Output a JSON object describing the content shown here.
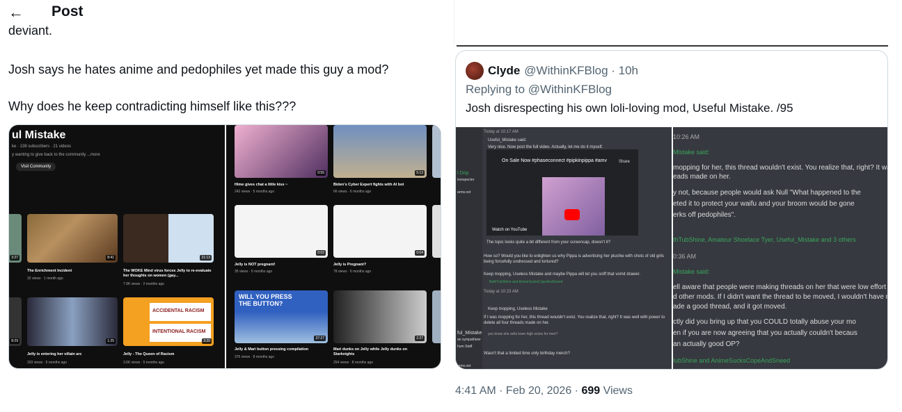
{
  "header": {
    "back_icon": "arrow-left-icon",
    "title": "Post"
  },
  "post": {
    "partial_line": "deviant.",
    "paragraph_1": "Josh says he hates anime and pedophiles yet made this guy a mod?",
    "paragraph_2": "Why does he keep contradicting himself like this???"
  },
  "media": {
    "channel": {
      "name": "ul Mistake",
      "subs": "ke · 138 subscribers · 21 videos",
      "desc": "y wanting to give back to the community ...more",
      "community_btn": "Visit Community"
    },
    "left_videos": [
      {
        "title": "The Enrichment Incident",
        "meta": "32 views · 1 month ago",
        "duration": "8:41"
      },
      {
        "title": "The WOKE Mind virus forces Jelly to re-evaluate her thoughts on women (gay...",
        "meta": "7.9K views · 2 months ago",
        "duration": "21:13"
      },
      {
        "title": "Jelly is entering her villain arc",
        "meta": "333 views · 5 months ago",
        "duration": "1:25"
      },
      {
        "title": "Jelly - The Queen of Racism",
        "meta": "3.6K views · 5 months ago",
        "duration": "3:20"
      }
    ],
    "racism_text_1": "ACCIDENTAL RACISM",
    "racism_text_2": "INTENTIONAL RACISM",
    "small_durations": [
      "3:27",
      "8:29"
    ],
    "right_videos": [
      {
        "title": "Hime gives chat a little kiss ~",
        "meta": "242 views · 5 months ago",
        "duration": "0:55"
      },
      {
        "title": "Biden's Cyber Expert fights with AI bot",
        "meta": "66 views · 6 months ago",
        "duration": "5:13"
      },
      {
        "title": "Jelly is NOT pregnant!",
        "meta": "35 views · 6 months ago",
        "duration": "0:02"
      },
      {
        "title": "Jelly is Pregnant?",
        "meta": "78 views · 6 months ago",
        "duration": "0:04"
      },
      {
        "title": "Jelly & Mari button pressing compilation",
        "meta": "376 views · 8 months ago",
        "duration": "37:27"
      },
      {
        "title": "Mari dunks on Jelly while Jelly dunks on Starknights",
        "meta": "254 views · 8 months ago",
        "duration": "2:27"
      }
    ],
    "button_text": "WILL YOU PRESS THE BUTTON?"
  },
  "quote": {
    "name": "Clyde",
    "handle": "@WithinKFBlog · 10h",
    "replying": "Replying to @WithinKFBlog",
    "text": "Josh disrespecting his own loli-loving mod, Useful Mistake. /95",
    "discord_left": {
      "timestamp": "Today at 10:17 AM",
      "quote_author": "Useful_Mistake said:",
      "quote_line": "Very nice. Now post the full video. Actually, let me do it myself.",
      "video_title": "On Sale Now #phaseconnect #pipkinpippa #amv",
      "share": "Share",
      "watch_on": "Watch on  YouTube",
      "caption": "The topic looks quite a bit different from your screencap, doesn't it?",
      "body1": "How so? Would you like to enlighten us why Pippa is advertising her plushie with shots of old girls being forcefully undressed and tortured?",
      "body2": "Keep mopping, Useless Mistake and maybe Pippa will let you sniff that vomit drawer.",
      "reactions": "BathTubShine and AnimeSucksCopeAndSneed",
      "timestamp2": "Today at 10:23 AM",
      "quote2": "Keep mopping, Useless Mistake",
      "body3": "If I was mopping for her, this thread wouldn't exist. You realize that, right? It was well with power to delete all four threads made on her.",
      "body4": "you know she sells knee high socks for men?",
      "body5": "Wasn't that a limited time only birthday merch?",
      "side_labels": [
        "l Drip",
        "isrespecter",
        "arms.net",
        "ful_Mistake",
        "an sympathizer",
        "hum Staff",
        "orms.net"
      ]
    },
    "discord_right": {
      "time1": "10:26 AM",
      "said1": "Mistake said:",
      "lines1": [
        "mopping for her, this thread wouldn't exist. You realize that, right? It was w",
        "eads made on her.",
        "",
        "y not, because people would ask Null \"What happened to the",
        "eted it to protect your waifu and your broom would be gone",
        "erks off pedophiles\"."
      ],
      "reactions1": "thTubShine, Amateur Shoelace Tyer, Useful_Mistake and 3 others",
      "time2": "0:36 AM",
      "said2": "Mistake said:",
      "lines2": [
        "ell aware that people were making threads on her that were low effort and",
        "d other mods. If I didn't want the thread to be moved, I wouldn't have mov",
        "ade a good thread, and it got moved.",
        "",
        "ctly did you bring up that you COULD totally abuse your mo",
        "en if you are now agreeing that you actually couldn't becaus",
        "an actually good OP?"
      ],
      "reactions2": "lubShine and AnimeSucksCopeAndSneed"
    }
  },
  "footer": {
    "time": "4:41 AM · Feb 20, 2026 · ",
    "views_count": "699",
    "views_label": " Views"
  }
}
